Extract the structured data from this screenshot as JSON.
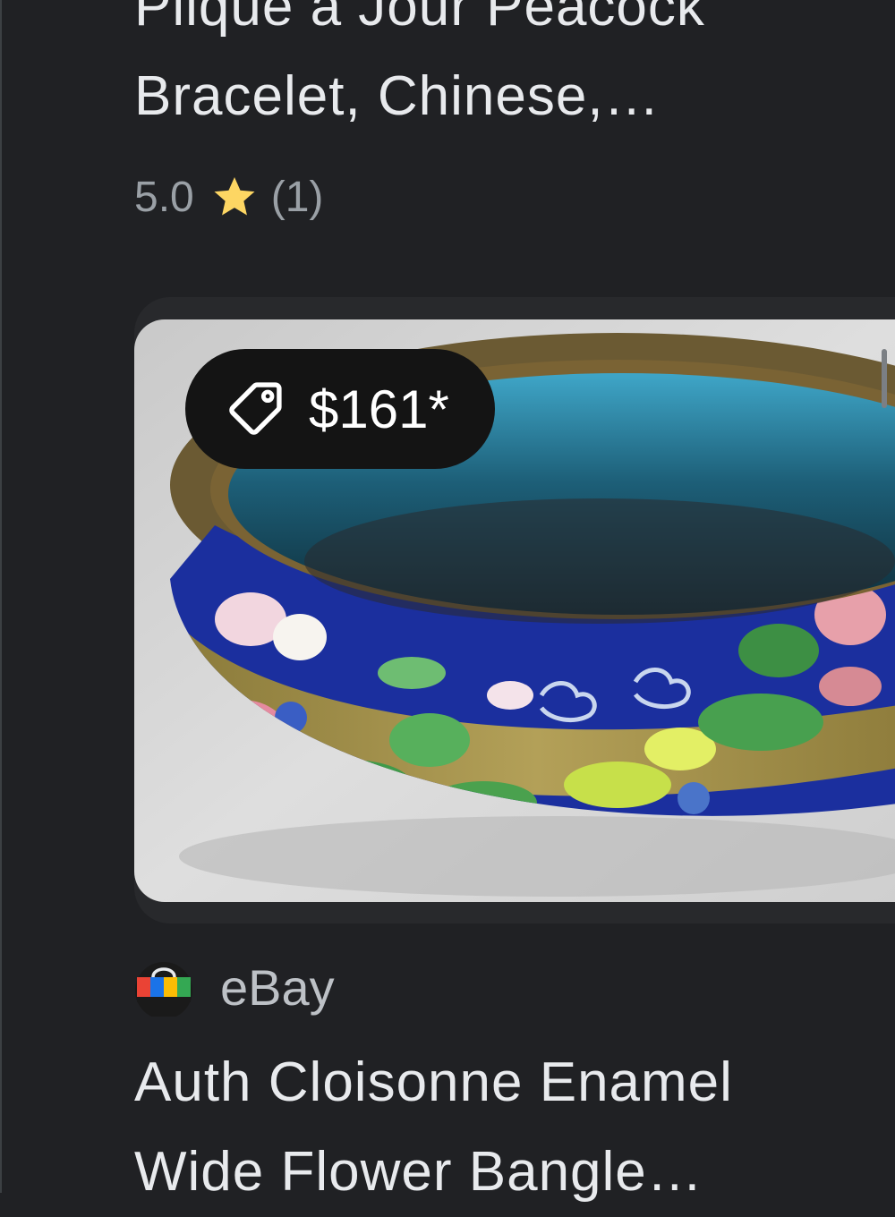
{
  "listings": [
    {
      "title": "Plique a Jour Peacock",
      "title_line2": "Bracelet, Chinese,…",
      "rating": {
        "value": "5.0",
        "count": "(1)",
        "star_color": "#fdd663"
      }
    },
    {
      "price": "$161*",
      "image_alt": "cloisonne-bangle-photo",
      "merchant": "eBay",
      "title": "Auth Cloisonne Enamel",
      "title_line2": "Wide Flower Bangle…"
    }
  ],
  "colors": {
    "background": "#202124",
    "card": "#28292c",
    "price_chip": "#141414",
    "text_primary": "#e8eaed",
    "text_secondary": "#9aa0a6"
  },
  "icons": {
    "rating_star": "star-icon",
    "price_tag": "tag-icon",
    "merchant_logo": "shopping-bag-icon"
  }
}
